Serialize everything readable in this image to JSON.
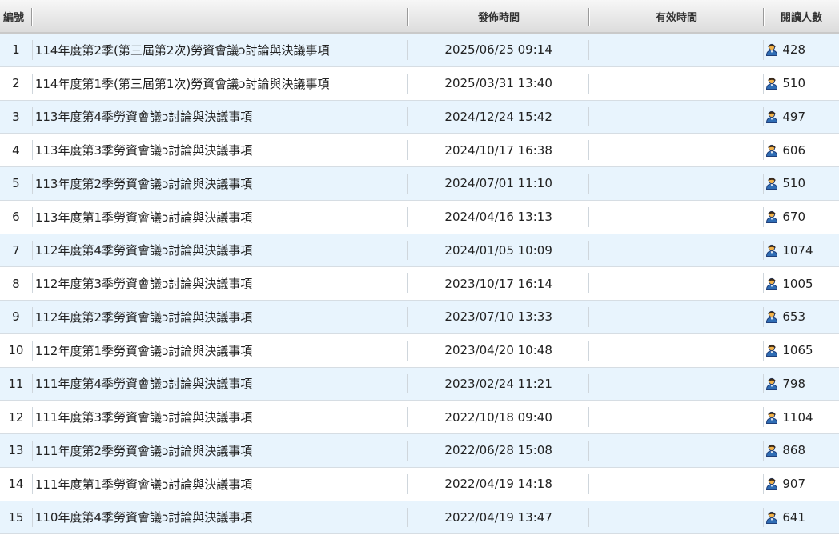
{
  "header": {
    "col_no": "編號",
    "col_title": "",
    "col_date": "發佈時間",
    "col_valid": "有效時間",
    "col_views": "閱讀人數"
  },
  "icons": {
    "views": "user-icon"
  },
  "colors": {
    "row_alt": "#e8f4fd",
    "row_plain": "#ffffff",
    "icon_blue": "#2f6db5",
    "icon_skin": "#f1b24a"
  },
  "rows": [
    {
      "no": "1",
      "title": "114年度第2季(第三屆第2次)勞資會議ɔ討論與決議事項",
      "date": "2025/06/25 09:14",
      "valid": "",
      "views": "428"
    },
    {
      "no": "2",
      "title": "114年度第1季(第三屆第1次)勞資會議ɔ討論與決議事項",
      "date": "2025/03/31 13:40",
      "valid": "",
      "views": "510"
    },
    {
      "no": "3",
      "title": "113年度第4季勞資會議ɔ討論與決議事項",
      "date": "2024/12/24 15:42",
      "valid": "",
      "views": "497"
    },
    {
      "no": "4",
      "title": "113年度第3季勞資會議ɔ討論與決議事項",
      "date": "2024/10/17 16:38",
      "valid": "",
      "views": "606"
    },
    {
      "no": "5",
      "title": "113年度第2季勞資會議ɔ討論與決議事項",
      "date": "2024/07/01 11:10",
      "valid": "",
      "views": "510"
    },
    {
      "no": "6",
      "title": "113年度第1季勞資會議ɔ討論與決議事項",
      "date": "2024/04/16 13:13",
      "valid": "",
      "views": "670"
    },
    {
      "no": "7",
      "title": "112年度第4季勞資會議ɔ討論與決議事項",
      "date": "2024/01/05 10:09",
      "valid": "",
      "views": "1074"
    },
    {
      "no": "8",
      "title": "112年度第3季勞資會議ɔ討論與決議事項",
      "date": "2023/10/17 16:14",
      "valid": "",
      "views": "1005"
    },
    {
      "no": "9",
      "title": "112年度第2季勞資會議ɔ討論與決議事項",
      "date": "2023/07/10 13:33",
      "valid": "",
      "views": "653"
    },
    {
      "no": "10",
      "title": "112年度第1季勞資會議ɔ討論與決議事項",
      "date": "2023/04/20 10:48",
      "valid": "",
      "views": "1065"
    },
    {
      "no": "11",
      "title": "111年度第4季勞資會議ɔ討論與決議事項",
      "date": "2023/02/24 11:21",
      "valid": "",
      "views": "798"
    },
    {
      "no": "12",
      "title": "111年度第3季勞資會議ɔ討論與決議事項",
      "date": "2022/10/18 09:40",
      "valid": "",
      "views": "1104"
    },
    {
      "no": "13",
      "title": "111年度第2季勞資會議ɔ討論與決議事項",
      "date": "2022/06/28 15:08",
      "valid": "",
      "views": "868"
    },
    {
      "no": "14",
      "title": "111年度第1季勞資會議ɔ討論與決議事項",
      "date": "2022/04/19 14:18",
      "valid": "",
      "views": "907"
    },
    {
      "no": "15",
      "title": "110年度第4季勞資會議ɔ討論與決議事項",
      "date": "2022/04/19 13:47",
      "valid": "",
      "views": "641"
    }
  ]
}
